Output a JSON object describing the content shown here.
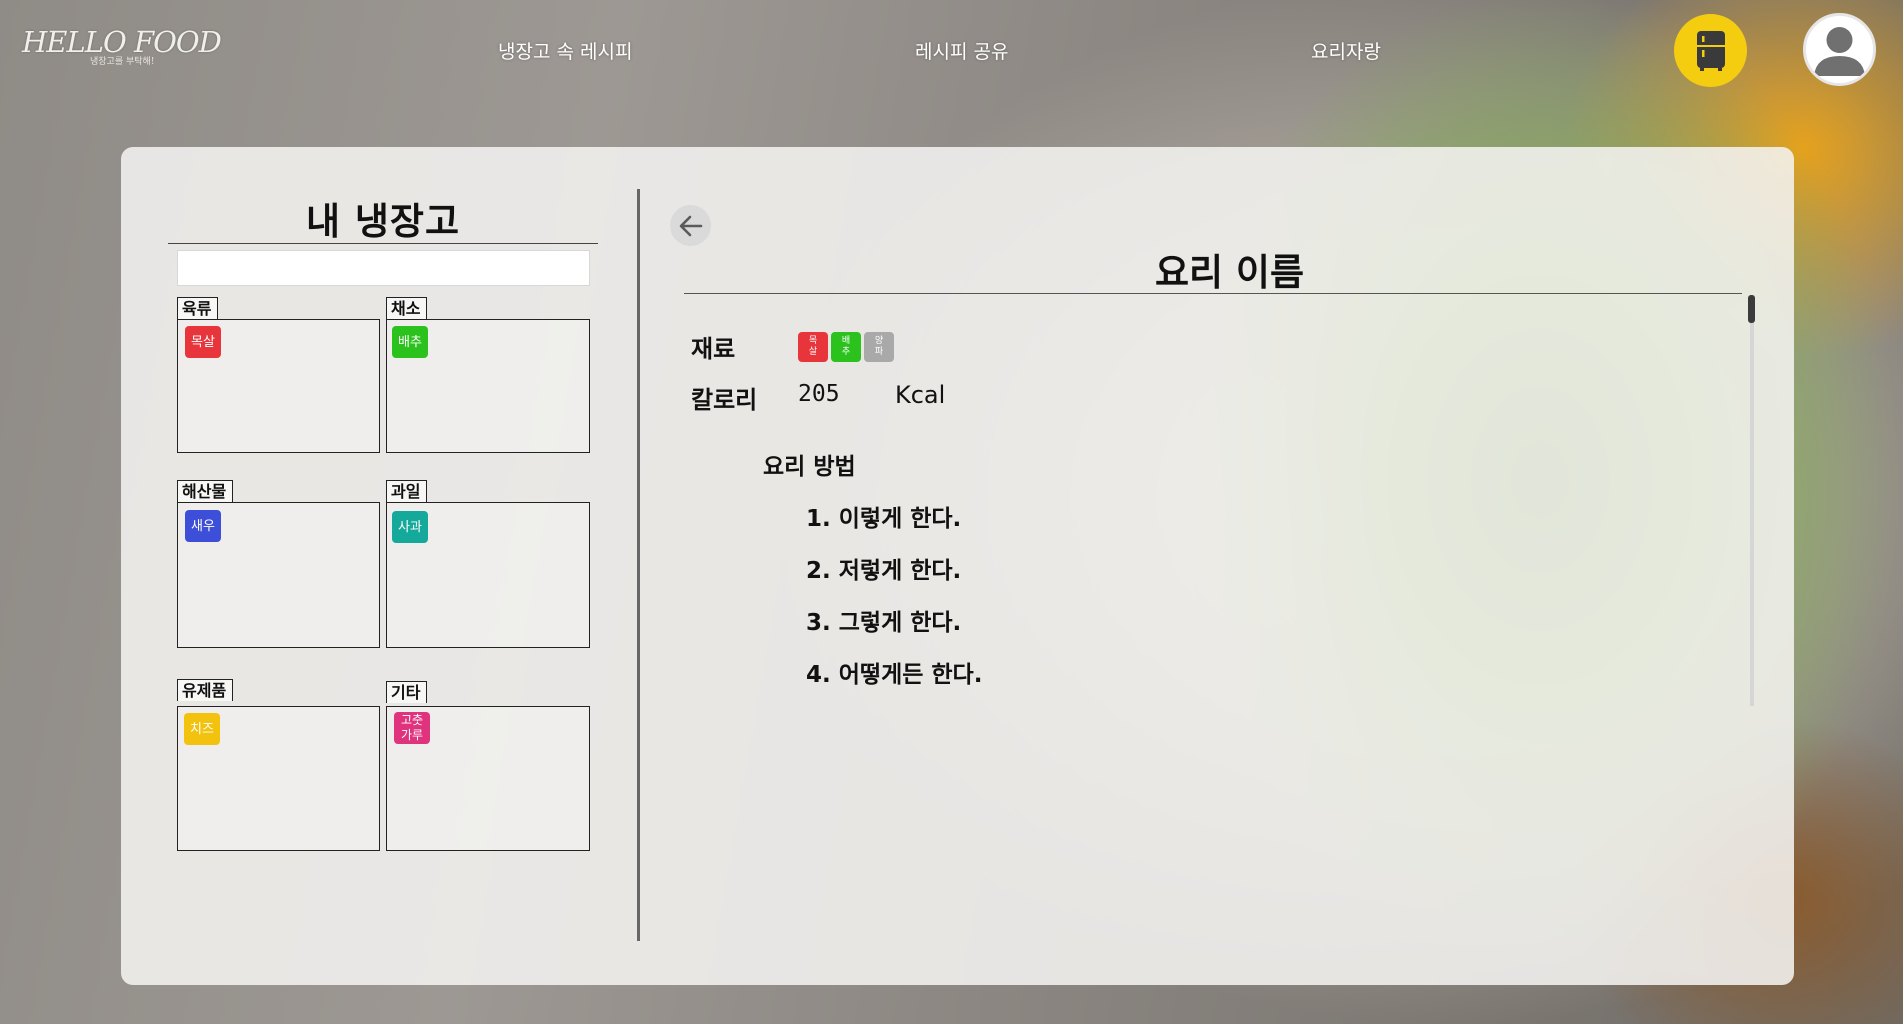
{
  "brand": {
    "logo": "HELLO FOOD",
    "tagline": "냉장고를 부탁해!"
  },
  "nav": {
    "links": [
      "냉장고 속 레시피",
      "레시피 공유",
      "요리자랑"
    ],
    "fridge_icon": "fridge-icon",
    "user_icon": "user-icon",
    "accent_color": "#f5cd10"
  },
  "fridge": {
    "title": "내 냉장고",
    "search": {
      "value": "",
      "placeholder": ""
    },
    "categories": [
      {
        "name": "육류",
        "items": [
          {
            "label": "목살",
            "color": "#e8353b"
          }
        ]
      },
      {
        "name": "채소",
        "items": [
          {
            "label": "배추",
            "color": "#2bc21e"
          }
        ]
      },
      {
        "name": "해산물",
        "items": [
          {
            "label": "새우",
            "color": "#3d4fd8"
          }
        ]
      },
      {
        "name": "과일",
        "items": [
          {
            "label": "사과",
            "color": "#14a99a"
          }
        ]
      },
      {
        "name": "유제품",
        "items": [
          {
            "label": "치즈",
            "color": "#f2c20f"
          }
        ]
      },
      {
        "name": "기타",
        "items": [
          {
            "label": "고춧\n가루",
            "color": "#e0337e"
          }
        ]
      }
    ]
  },
  "recipe": {
    "back_icon": "arrow-left-icon",
    "title": "요리 이름",
    "ingredients_label": "재료",
    "ingredients": [
      {
        "label": "목\n살",
        "color": "#e8353b"
      },
      {
        "label": "배\n추",
        "color": "#2bc21e"
      },
      {
        "label": "양\n파",
        "color": "#a9a9a9"
      }
    ],
    "calorie_label": "칼로리",
    "calorie_value": "205",
    "calorie_unit": "Kcal",
    "method_label": "요리 방법",
    "steps": [
      "1. 이렇게 한다.",
      "2. 저렇게 한다.",
      "3. 그렇게 한다.",
      "4. 어떻게든 한다."
    ]
  }
}
